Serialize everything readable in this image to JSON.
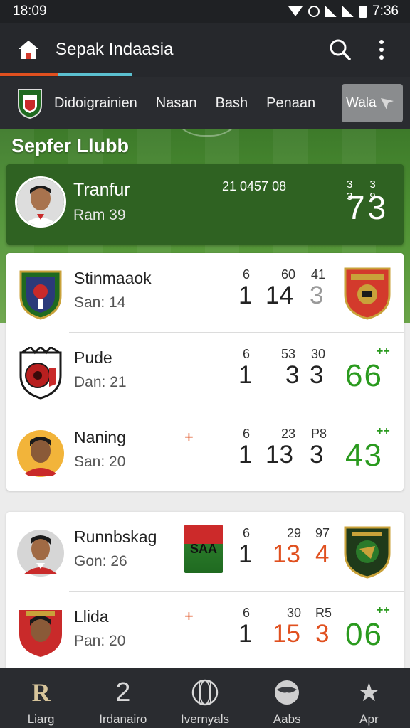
{
  "status_bar": {
    "time": "18:09",
    "clock": "7:36"
  },
  "app_bar": {
    "title": "Sepak Indaasia"
  },
  "tabs": {
    "items": [
      "Didoigrainien",
      "Nasan",
      "Bash",
      "Penaan"
    ],
    "chip_label": "Wala"
  },
  "section": {
    "title": "Sepfer Llubb"
  },
  "featured": {
    "name": "Tranfur",
    "sub": "Ram 39",
    "meta": "21 0457 08",
    "small": "33 39",
    "score": "73"
  },
  "card1": {
    "rows": [
      {
        "name": "Stinmaaok",
        "sub": "San: 14",
        "s1": "6",
        "s2": "60",
        "s3": "41",
        "b1": "1",
        "b2": "14",
        "b3": "3",
        "b3_color": "#9a9a9a"
      },
      {
        "name": "Pude",
        "sub": "Dan: 21",
        "s1": "6",
        "s2": "53",
        "s3": "30",
        "b1": "1",
        "b2": "3",
        "b3": "3",
        "right_small": "++",
        "right_score": "66"
      },
      {
        "name": "Naning",
        "sub": "San: 20",
        "plus": "+",
        "s1": "6",
        "s2": "23",
        "s3": "P8",
        "b1": "1",
        "b2": "13",
        "b3": "3",
        "right_small": "++",
        "right_score": "43"
      }
    ]
  },
  "card2": {
    "rows": [
      {
        "name": "Runnbskag",
        "sub": "Gon: 26",
        "tag": "SAA",
        "s1": "6",
        "s2": "29",
        "s3": "97",
        "b1": "1",
        "b2": "13",
        "b3": "4"
      },
      {
        "name": "Llida",
        "sub": "Pan: 20",
        "plus": "+",
        "s1": "6",
        "s2": "30",
        "s3": "R5",
        "b1": "1",
        "b2": "15",
        "b3": "3",
        "right_small": "++",
        "right_score": "06"
      }
    ]
  },
  "bottom_nav": {
    "items": [
      {
        "label": "Liarg",
        "glyph": "R"
      },
      {
        "label": "Irdanairo",
        "glyph": "2"
      },
      {
        "label": "Ivernyals",
        "glyph": ""
      },
      {
        "label": "Aabs",
        "glyph": ""
      },
      {
        "label": "Apr",
        "glyph": "★"
      }
    ]
  },
  "colors": {
    "accent_green": "#2a9a1e",
    "accent_orange": "#e0501f",
    "app_bar": "#26282c",
    "field_green": "#4e9233"
  },
  "icons": [
    "home-icon",
    "search-icon",
    "more-vert-icon",
    "club-crest-icon",
    "chip-arrow-icon",
    "globe-icon",
    "ball-icon",
    "star-icon"
  ]
}
